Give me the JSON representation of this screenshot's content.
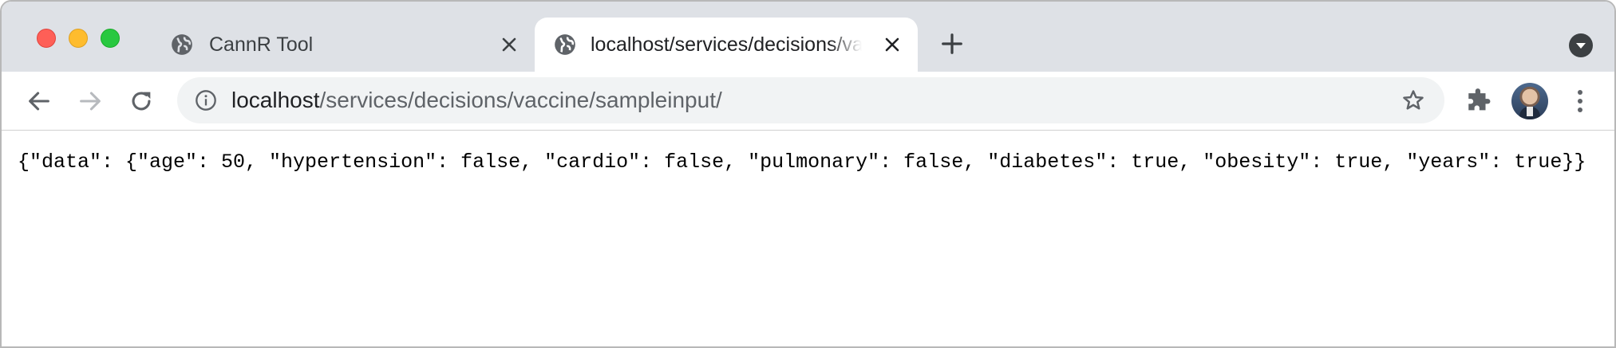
{
  "tabs": [
    {
      "title": "CannR Tool",
      "active": false,
      "favicon": "globe-icon"
    },
    {
      "title": "localhost/services/decisions/vaccine/sampleinput/",
      "active": true,
      "favicon": "globe-icon"
    }
  ],
  "omnibox": {
    "host": "localhost",
    "path": "/services/decisions/vaccine/sampleinput/"
  },
  "page": {
    "body_text": "{\"data\": {\"age\": 50, \"hypertension\": false, \"cardio\": false, \"pulmonary\": false, \"diabetes\": true, \"obesity\": true, \"years\": true}}"
  },
  "colors": {
    "tabbar": "#dee1e6",
    "omnibox": "#f1f3f4",
    "icon": "#5f6368",
    "close_red": "#fe5f57",
    "minimize_yellow": "#febc2e",
    "zoom_green": "#28c840"
  }
}
